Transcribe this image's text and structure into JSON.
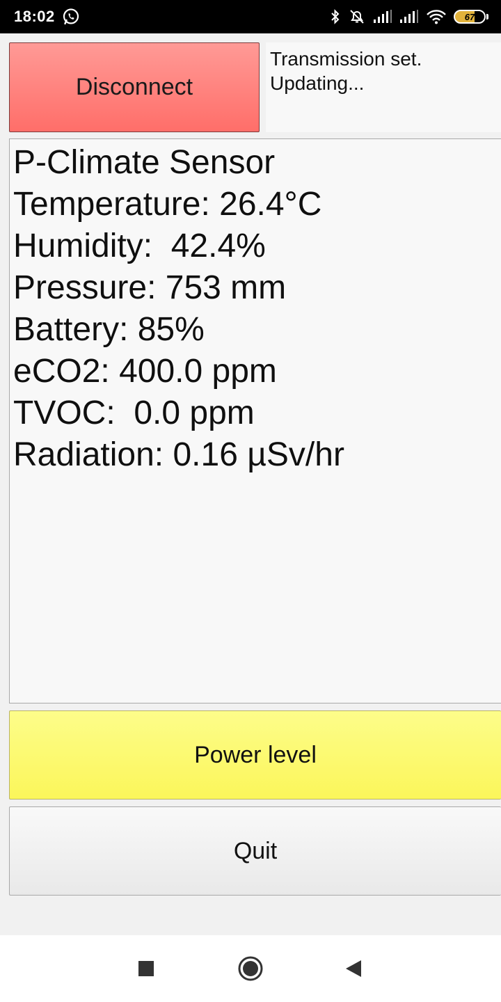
{
  "status_bar": {
    "time": "18:02",
    "battery_level": "67",
    "icons": [
      "whatsapp-icon",
      "bluetooth-icon",
      "alarm-off-icon",
      "signal-icon",
      "signal-icon",
      "wifi-icon",
      "battery-icon"
    ]
  },
  "controls": {
    "disconnect_label": "Disconnect",
    "status_message": "Transmission set.\nUpdating...",
    "power_label": "Power level",
    "quit_label": "Quit"
  },
  "readout": {
    "lines": [
      "P-Climate Sensor",
      "Temperature: 26.4°C",
      "Humidity:  42.4%",
      "Pressure: 753 mm",
      "Battery: 85%",
      "eCO2: 400.0 ppm",
      "TVOC:  0.0 ppm",
      "Radiation: 0.16 µSv/hr"
    ]
  },
  "colors": {
    "disconnect": "#ff7f7b",
    "power": "#fcf96e",
    "quit": "#f2f2f2"
  },
  "nav": {
    "icons": [
      "recents-square-icon",
      "home-circle-icon",
      "back-triangle-icon"
    ]
  }
}
